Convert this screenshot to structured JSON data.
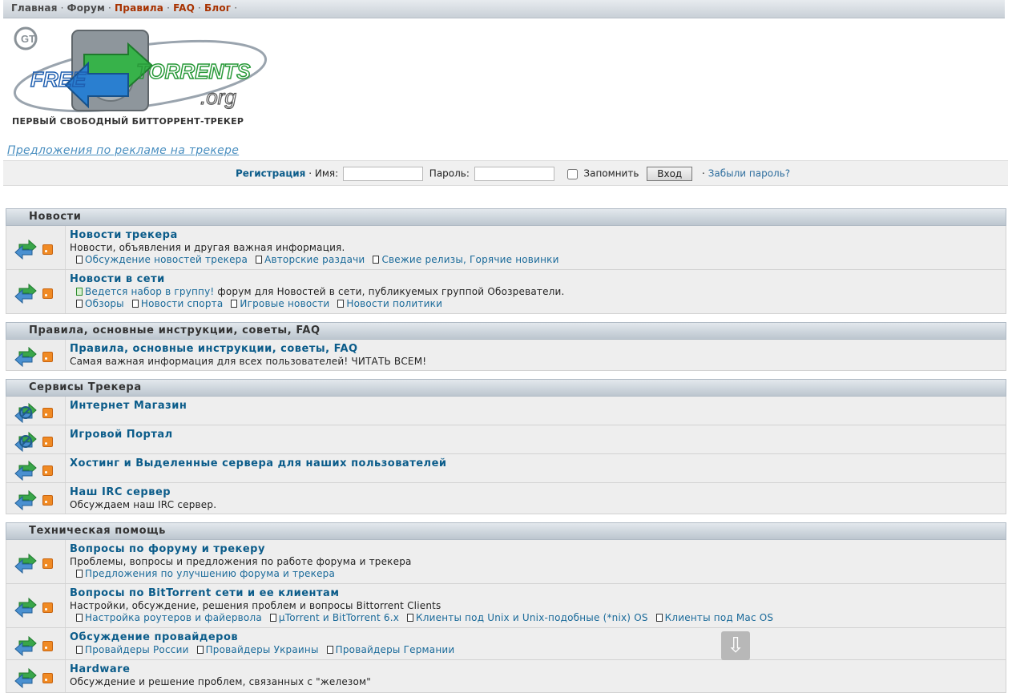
{
  "nav": {
    "items": [
      {
        "label": "Главная",
        "red": false
      },
      {
        "label": "Форум",
        "red": false
      },
      {
        "label": "Правила",
        "red": true
      },
      {
        "label": "FAQ",
        "red": true
      },
      {
        "label": "Блог",
        "red": true
      }
    ]
  },
  "logo": {
    "gt": "GT",
    "free": "FREE",
    "torrents": "TORRENTS",
    "org": ".org",
    "slogan": "ПЕРВЫЙ СВОБОДНЫЙ БИТТОРРЕНТ-ТРЕКЕР"
  },
  "ad_link": "Предложения по рекламе на трекере",
  "login": {
    "register": "Регистрация",
    "name_label": "Имя:",
    "password_label": "Пароль:",
    "remember_label": "Запомнить",
    "submit": "Вход",
    "forgot": "Забыли пароль?"
  },
  "categories": [
    {
      "name": "Новости",
      "forums": [
        {
          "title": "Новости трекера",
          "desc": "Новости, объявления и другая важная информация.",
          "subs": [
            "Обсуждение новостей трекера",
            "Авторские раздачи",
            "Свежие релизы, Горячие новинки"
          ],
          "icon": "arrow"
        },
        {
          "title": "Новости в сети",
          "notice": "Ведется набор в группу!",
          "notice_rest": " форум для Новостей в сети, публикуемых группой Обозреватели.",
          "subs": [
            "Обзоры",
            "Новости спорта",
            "Игровые новости",
            "Новости политики"
          ],
          "icon": "arrow"
        }
      ]
    },
    {
      "name": "Правила, основные инструкции, советы, FAQ",
      "forums": [
        {
          "title": "Правила, основные инструкции, советы, FAQ",
          "desc": "Самая важная информация для всех пользователей! ЧИТАТЬ ВСЕМ!",
          "subs": [],
          "icon": "arrow"
        }
      ]
    },
    {
      "name": "Сервисы Трекера",
      "forums": [
        {
          "title": "Интернет Магазин",
          "desc": "",
          "subs": [],
          "icon": "link"
        },
        {
          "title": "Игровой Портал",
          "desc": "",
          "subs": [],
          "icon": "link"
        },
        {
          "title": "Хостинг и Выделенные сервера для наших пользователей",
          "desc": "",
          "subs": [],
          "icon": "arrow"
        },
        {
          "title": "Наш IRC сервер",
          "desc": "Обсуждаем наш IRC сервер.",
          "subs": [],
          "icon": "arrow"
        }
      ]
    },
    {
      "name": "Техническая помощь",
      "forums": [
        {
          "title": "Вопросы по форуму и трекеру",
          "desc": "Проблемы, вопросы и предложения по работе форума и трекера",
          "subs": [
            "Предложения по улучшению форума и трекера"
          ],
          "icon": "arrow"
        },
        {
          "title": "Вопросы по BitTorrent сети и ее клиентам",
          "desc": "Настройки, обсуждение, решения проблем и вопросы Bittorrent Clients",
          "subs": [
            "Настройка роутеров и файервола",
            "µTorrent и BitTorrent 6.x",
            "Клиенты под Unix и Unix-подобные (*nix) OS",
            "Клиенты под Mac OS"
          ],
          "icon": "arrow"
        },
        {
          "title": "Обсуждение провайдеров",
          "desc": "",
          "subs": [
            "Провайдеры России",
            "Провайдеры Украины",
            "Провайдеры Германии"
          ],
          "icon": "arrow"
        },
        {
          "title": "Hardware",
          "desc": "Обсуждение и решение проблем, связанных с \"железом\"",
          "subs": [],
          "icon": "arrow"
        }
      ]
    }
  ],
  "scroll_button": "⇩"
}
